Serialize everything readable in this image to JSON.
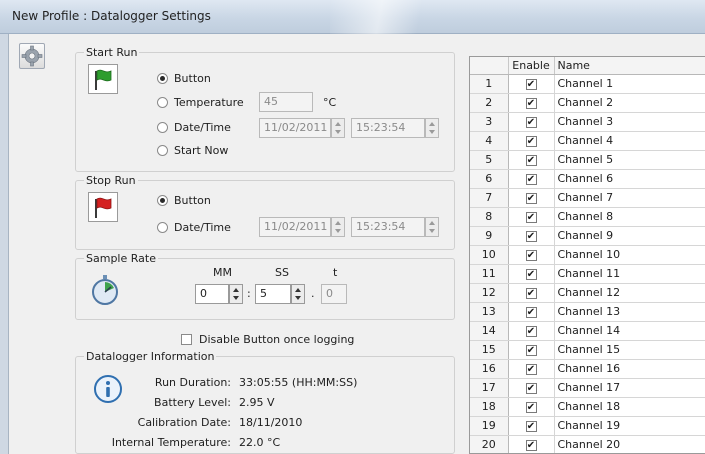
{
  "window": {
    "title": "New Profile : Datalogger Settings"
  },
  "start_run": {
    "legend": "Start Run",
    "options": [
      {
        "label": "Button",
        "selected": true
      },
      {
        "label": "Temperature",
        "selected": false
      },
      {
        "label": "Date/Time",
        "selected": false
      },
      {
        "label": "Start Now",
        "selected": false
      }
    ],
    "temperature": {
      "value": "45",
      "unit": "°C"
    },
    "date": "11/02/2011",
    "time": "15:23:54"
  },
  "stop_run": {
    "legend": "Stop Run",
    "options": [
      {
        "label": "Button",
        "selected": true
      },
      {
        "label": "Date/Time",
        "selected": false
      }
    ],
    "date": "11/02/2011",
    "time": "15:23:54"
  },
  "sample_rate": {
    "legend": "Sample Rate",
    "mm_label": "MM",
    "ss_label": "SS",
    "t_label": "t",
    "mm": "0",
    "ss": "5",
    "t": "0",
    "colon": ":",
    "dot": "."
  },
  "disable_button": {
    "label": "Disable Button once logging",
    "checked": false
  },
  "info": {
    "legend": "Datalogger Information",
    "rows": [
      {
        "label": "Run Duration:",
        "value": "33:05:55 (HH:MM:SS)"
      },
      {
        "label": "Battery Level:",
        "value": "2.95 V"
      },
      {
        "label": "Calibration Date:",
        "value": "18/11/2010"
      },
      {
        "label": "Internal Temperature:",
        "value": "22.0 °C"
      }
    ]
  },
  "channels": {
    "headers": {
      "num": "",
      "enable": "Enable",
      "name": "Name"
    },
    "rows": [
      {
        "num": "1",
        "enabled": true,
        "name": "Channel 1"
      },
      {
        "num": "2",
        "enabled": true,
        "name": "Channel 2"
      },
      {
        "num": "3",
        "enabled": true,
        "name": "Channel 3"
      },
      {
        "num": "4",
        "enabled": true,
        "name": "Channel 4"
      },
      {
        "num": "5",
        "enabled": true,
        "name": "Channel 5"
      },
      {
        "num": "6",
        "enabled": true,
        "name": "Channel 6"
      },
      {
        "num": "7",
        "enabled": true,
        "name": "Channel 7"
      },
      {
        "num": "8",
        "enabled": true,
        "name": "Channel 8"
      },
      {
        "num": "9",
        "enabled": true,
        "name": "Channel 9"
      },
      {
        "num": "10",
        "enabled": true,
        "name": "Channel 10"
      },
      {
        "num": "11",
        "enabled": true,
        "name": "Channel 11"
      },
      {
        "num": "12",
        "enabled": true,
        "name": "Channel 12"
      },
      {
        "num": "13",
        "enabled": true,
        "name": "Channel 13"
      },
      {
        "num": "14",
        "enabled": true,
        "name": "Channel 14"
      },
      {
        "num": "15",
        "enabled": true,
        "name": "Channel 15"
      },
      {
        "num": "16",
        "enabled": true,
        "name": "Channel 16"
      },
      {
        "num": "17",
        "enabled": true,
        "name": "Channel 17"
      },
      {
        "num": "18",
        "enabled": true,
        "name": "Channel 18"
      },
      {
        "num": "19",
        "enabled": true,
        "name": "Channel 19"
      },
      {
        "num": "20",
        "enabled": true,
        "name": "Channel 20"
      }
    ]
  },
  "colors": {
    "flag_green": "#2e9d2e",
    "flag_red": "#d42020",
    "info_blue": "#2f6fb0"
  }
}
